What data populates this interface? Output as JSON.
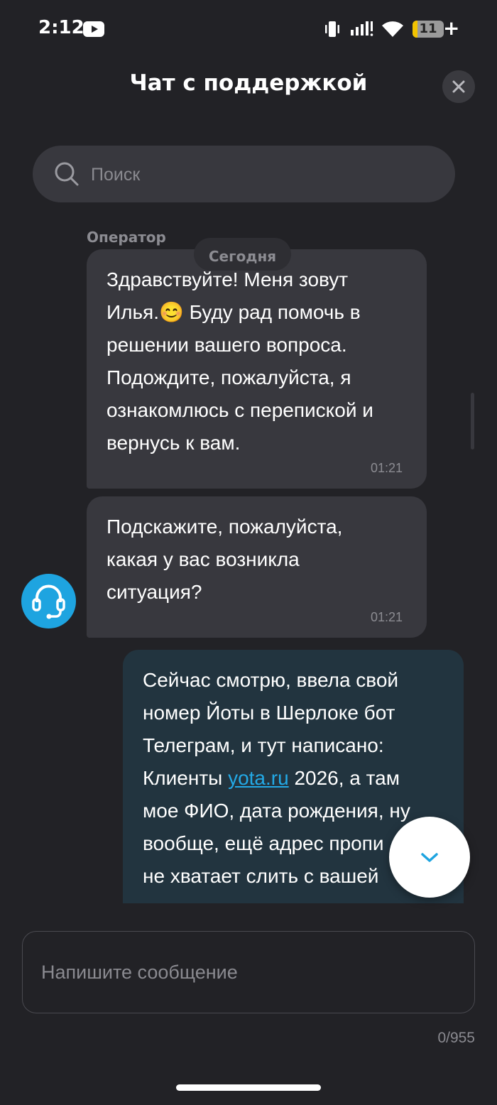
{
  "status_bar": {
    "time": "2:12",
    "battery_level": "11",
    "icons": [
      "youtube-icon",
      "vibrate-icon",
      "signal-icon",
      "wifi-icon",
      "battery-icon"
    ]
  },
  "header": {
    "title": "Чат с поддержкой",
    "close_icon": "close-icon"
  },
  "search": {
    "placeholder": "Поиск",
    "value": ""
  },
  "chat": {
    "date_chip": "Сегодня",
    "sender_label": "Оператор",
    "messages": [
      {
        "from": "operator",
        "text": "Здравствуйте! Меня зовут\nИлья.😊 Буду рад помочь в\nрешении вашего вопроса.\nПодождите, пожалуйста, я\nознакомлюсь с перепиской и\nвернусь к вам.",
        "time": "01:21"
      },
      {
        "from": "operator",
        "text": "Подскажите, пожалуйста,\nкакая у вас возникла\nситуация?",
        "time": "01:21"
      },
      {
        "from": "user",
        "text_before_link": "Сейчас смотрю, ввела свой\nномер Йоты в Шерлоке бот\nТелеграм, и тут написано:\nКлиенты ",
        "link_text": "yota.ru",
        "text_after_link": " 2026, а там\nмое ФИО, дата рождения, ну\nвообще, ещё адрес пропи\nне хватает слить с вашей\nстороны"
      }
    ]
  },
  "composer": {
    "placeholder": "Напишите сообщение",
    "value": "",
    "counter": "0/955"
  },
  "colors": {
    "background": "#222226",
    "operator_bubble": "#38383e",
    "user_bubble": "#22343f",
    "accent": "#1ea4e0",
    "link": "#23a9e6"
  }
}
